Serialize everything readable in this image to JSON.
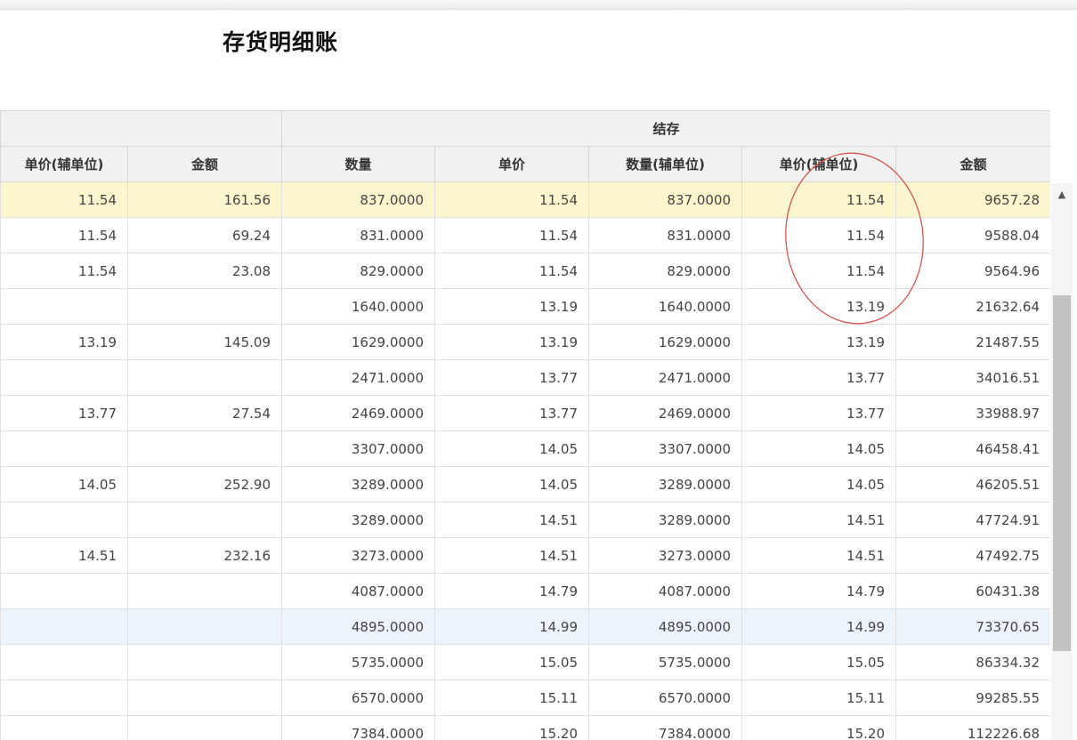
{
  "title": "存货明细账",
  "group_header": "结存",
  "columns": [
    "单价(辅单位)",
    "金额",
    "数量",
    "单价",
    "数量(辅单位)",
    "单价(辅单位)",
    "金额"
  ],
  "rows": [
    [
      "11.54",
      "161.56",
      "837.0000",
      "11.54",
      "837.0000",
      "11.54",
      "9657.28"
    ],
    [
      "11.54",
      "69.24",
      "831.0000",
      "11.54",
      "831.0000",
      "11.54",
      "9588.04"
    ],
    [
      "11.54",
      "23.08",
      "829.0000",
      "11.54",
      "829.0000",
      "11.54",
      "9564.96"
    ],
    [
      "",
      "",
      "1640.0000",
      "13.19",
      "1640.0000",
      "13.19",
      "21632.64"
    ],
    [
      "13.19",
      "145.09",
      "1629.0000",
      "13.19",
      "1629.0000",
      "13.19",
      "21487.55"
    ],
    [
      "",
      "",
      "2471.0000",
      "13.77",
      "2471.0000",
      "13.77",
      "34016.51"
    ],
    [
      "13.77",
      "27.54",
      "2469.0000",
      "13.77",
      "2469.0000",
      "13.77",
      "33988.97"
    ],
    [
      "",
      "",
      "3307.0000",
      "14.05",
      "3307.0000",
      "14.05",
      "46458.41"
    ],
    [
      "14.05",
      "252.90",
      "3289.0000",
      "14.05",
      "3289.0000",
      "14.05",
      "46205.51"
    ],
    [
      "",
      "",
      "3289.0000",
      "14.51",
      "3289.0000",
      "14.51",
      "47724.91"
    ],
    [
      "14.51",
      "232.16",
      "3273.0000",
      "14.51",
      "3273.0000",
      "14.51",
      "47492.75"
    ],
    [
      "",
      "",
      "4087.0000",
      "14.79",
      "4087.0000",
      "14.79",
      "60431.38"
    ],
    [
      "",
      "",
      "4895.0000",
      "14.99",
      "4895.0000",
      "14.99",
      "73370.65"
    ],
    [
      "",
      "",
      "5735.0000",
      "15.05",
      "5735.0000",
      "15.05",
      "86334.32"
    ],
    [
      "",
      "",
      "6570.0000",
      "15.11",
      "6570.0000",
      "15.11",
      "99285.55"
    ],
    [
      "",
      "",
      "7384.0000",
      "15.20",
      "7384.0000",
      "15.20",
      "112226.68"
    ]
  ],
  "icons": {
    "scroll_up": "scroll-up-arrow-icon"
  },
  "colors": {
    "selected_row": "#fcf6cf",
    "hover_row": "#edf3fb",
    "annotation_circle": "#d9534f"
  }
}
